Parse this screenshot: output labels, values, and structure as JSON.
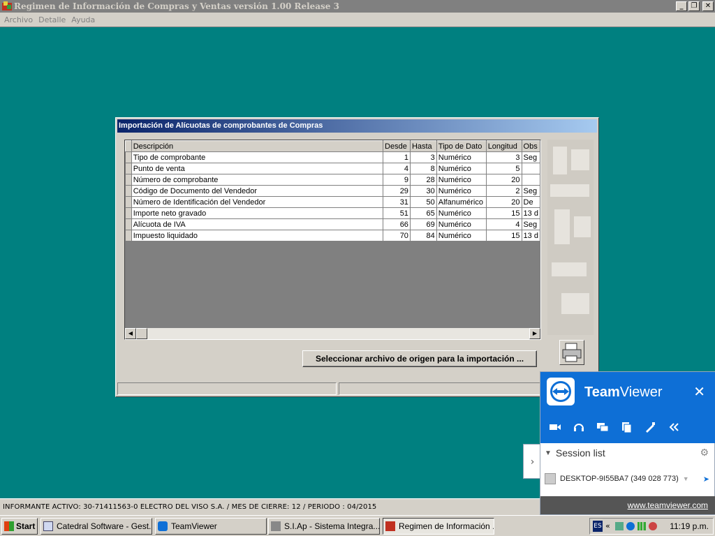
{
  "app": {
    "title": "Regimen de Información de Compras y Ventas versión 1.00   Release 3",
    "menu": [
      "Archivo",
      "Detalle",
      "Ayuda"
    ],
    "window_buttons": [
      "_",
      "❐",
      "✕"
    ],
    "status": "INFORMANTE ACTIVO: 30-71411563-0 ELECTRO DEL VISO S.A. / MES DE CIERRE: 12 / PERIODO : 04/2015"
  },
  "dialog": {
    "title": "Importación de Alícuotas de comprobantes de Compras",
    "columns": [
      "Descripción",
      "Desde",
      "Hasta",
      "Tipo de Dato",
      "Longitud",
      "Obs"
    ],
    "rows": [
      {
        "descripcion": "Tipo de comprobante",
        "desde": "1",
        "hasta": "3",
        "tipo": "Numérico",
        "longitud": "3",
        "obs": "Seg"
      },
      {
        "descripcion": "Punto de venta",
        "desde": "4",
        "hasta": "8",
        "tipo": "Numérico",
        "longitud": "5",
        "obs": ""
      },
      {
        "descripcion": "Número de comprobante",
        "desde": "9",
        "hasta": "28",
        "tipo": "Numérico",
        "longitud": "20",
        "obs": ""
      },
      {
        "descripcion": "Código de Documento del Vendedor",
        "desde": "29",
        "hasta": "30",
        "tipo": "Numérico",
        "longitud": "2",
        "obs": "Seg"
      },
      {
        "descripcion": "Número de Identificación del Vendedor",
        "desde": "31",
        "hasta": "50",
        "tipo": "Alfanumérico",
        "longitud": "20",
        "obs": "De"
      },
      {
        "descripcion": "Importe neto gravado",
        "desde": "51",
        "hasta": "65",
        "tipo": "Numérico",
        "longitud": "15",
        "obs": "13 d"
      },
      {
        "descripcion": "Alícuota de IVA",
        "desde": "66",
        "hasta": "69",
        "tipo": "Numérico",
        "longitud": "4",
        "obs": "Seg"
      },
      {
        "descripcion": "Impuesto liquidado",
        "desde": "70",
        "hasta": "84",
        "tipo": "Numérico",
        "longitud": "15",
        "obs": "13 d"
      }
    ],
    "select_button": "Seleccionar archivo de origen para la importación ..."
  },
  "teamviewer": {
    "brand_bold": "Team",
    "brand_rest": "Viewer",
    "close": "✕",
    "session_list": "Session list",
    "session_item": "DESKTOP-9I55BA7 (349 028 773)",
    "link": "www.teamviewer.com",
    "tools": [
      "video-icon",
      "headset-icon",
      "chat-icon",
      "files-icon",
      "whiteboard-icon",
      "collapse-icon"
    ]
  },
  "taskbar": {
    "start": "Start",
    "tasks": [
      "Catedral Software - Gest...",
      "TeamViewer",
      "S.I.Ap - Sistema Integra...",
      "Regimen de Información ..."
    ],
    "language": "ES",
    "clock": "11:19 p.m."
  }
}
